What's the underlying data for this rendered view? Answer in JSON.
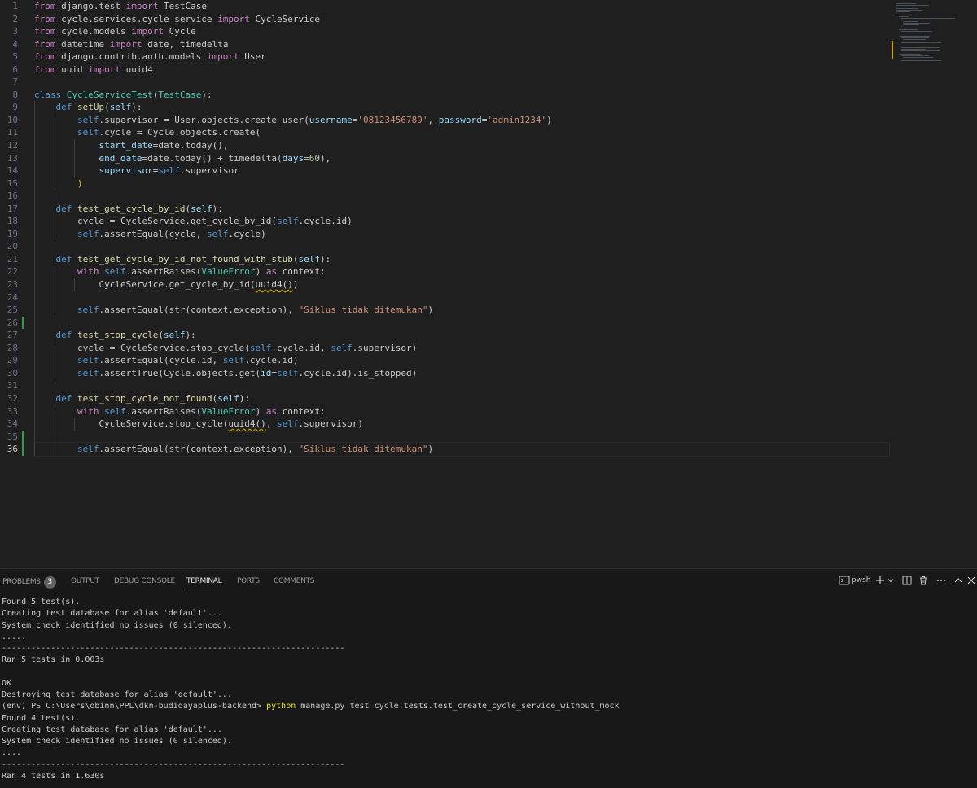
{
  "editor": {
    "active_line": 36,
    "lines": [
      [
        [
          "kw",
          "from"
        ],
        [
          "plain",
          " django.test "
        ],
        [
          "kw",
          "import"
        ],
        [
          "plain",
          " TestCase"
        ]
      ],
      [
        [
          "kw",
          "from"
        ],
        [
          "plain",
          " cycle.services.cycle_service "
        ],
        [
          "kw",
          "import"
        ],
        [
          "plain",
          " CycleService"
        ]
      ],
      [
        [
          "kw",
          "from"
        ],
        [
          "plain",
          " cycle.models "
        ],
        [
          "kw",
          "import"
        ],
        [
          "plain",
          " Cycle"
        ]
      ],
      [
        [
          "kw",
          "from"
        ],
        [
          "plain",
          " datetime "
        ],
        [
          "kw",
          "import"
        ],
        [
          "plain",
          " date, timedelta"
        ]
      ],
      [
        [
          "kw",
          "from"
        ],
        [
          "plain",
          " django.contrib.auth.models "
        ],
        [
          "kw",
          "import"
        ],
        [
          "plain",
          " User"
        ]
      ],
      [
        [
          "kw",
          "from"
        ],
        [
          "plain",
          " uuid "
        ],
        [
          "kw",
          "import"
        ],
        [
          "plain",
          " uuid4"
        ]
      ],
      [],
      [
        [
          "def",
          "class"
        ],
        [
          "plain",
          " "
        ],
        [
          "cls",
          "CycleServiceTest"
        ],
        [
          "plain",
          "("
        ],
        [
          "cls",
          "TestCase"
        ],
        [
          "plain",
          "):"
        ]
      ],
      [
        [
          "plain",
          "    "
        ],
        [
          "def",
          "def"
        ],
        [
          "plain",
          " "
        ],
        [
          "fn",
          "setUp"
        ],
        [
          "plain",
          "("
        ],
        [
          "param",
          "self"
        ],
        [
          "plain",
          "):"
        ]
      ],
      [
        [
          "plain",
          "        "
        ],
        [
          "self",
          "self"
        ],
        [
          "plain",
          ".supervisor = User.objects.create_user("
        ],
        [
          "param",
          "username"
        ],
        [
          "plain",
          "="
        ],
        [
          "str",
          "'08123456789'"
        ],
        [
          "plain",
          ", "
        ],
        [
          "param",
          "password"
        ],
        [
          "plain",
          "="
        ],
        [
          "str",
          "'admin1234'"
        ],
        [
          "plain",
          ")"
        ]
      ],
      [
        [
          "plain",
          "        "
        ],
        [
          "self",
          "self"
        ],
        [
          "plain",
          ".cycle = Cycle.objects.create("
        ]
      ],
      [
        [
          "plain",
          "            "
        ],
        [
          "param",
          "start_date"
        ],
        [
          "plain",
          "=date.today(),"
        ]
      ],
      [
        [
          "plain",
          "            "
        ],
        [
          "param",
          "end_date"
        ],
        [
          "plain",
          "=date.today() + timedelta("
        ],
        [
          "param",
          "days"
        ],
        [
          "plain",
          "="
        ],
        [
          "num",
          "60"
        ],
        [
          "plain",
          "),"
        ]
      ],
      [
        [
          "plain",
          "            "
        ],
        [
          "param",
          "supervisor"
        ],
        [
          "plain",
          "="
        ],
        [
          "self",
          "self"
        ],
        [
          "plain",
          ".supervisor"
        ]
      ],
      [
        [
          "plain",
          "        "
        ],
        [
          "brk",
          ")"
        ]
      ],
      [],
      [
        [
          "plain",
          "    "
        ],
        [
          "def",
          "def"
        ],
        [
          "plain",
          " "
        ],
        [
          "fn",
          "test_get_cycle_by_id"
        ],
        [
          "plain",
          "("
        ],
        [
          "param",
          "self"
        ],
        [
          "plain",
          "):"
        ]
      ],
      [
        [
          "plain",
          "        cycle = CycleService.get_cycle_by_id("
        ],
        [
          "self",
          "self"
        ],
        [
          "plain",
          ".cycle.id)"
        ]
      ],
      [
        [
          "plain",
          "        "
        ],
        [
          "self",
          "self"
        ],
        [
          "plain",
          ".assertEqual(cycle, "
        ],
        [
          "self",
          "self"
        ],
        [
          "plain",
          ".cycle)"
        ]
      ],
      [],
      [
        [
          "plain",
          "    "
        ],
        [
          "def",
          "def"
        ],
        [
          "plain",
          " "
        ],
        [
          "fn",
          "test_get_cycle_by_id_not_found_with_stub"
        ],
        [
          "plain",
          "("
        ],
        [
          "param",
          "self"
        ],
        [
          "plain",
          "):"
        ]
      ],
      [
        [
          "plain",
          "        "
        ],
        [
          "kw",
          "with"
        ],
        [
          "plain",
          " "
        ],
        [
          "self",
          "self"
        ],
        [
          "plain",
          ".assertRaises("
        ],
        [
          "cls",
          "ValueError"
        ],
        [
          "plain",
          ") "
        ],
        [
          "kw",
          "as"
        ],
        [
          "plain",
          " context:"
        ]
      ],
      [
        [
          "plain",
          "            CycleService.get_cycle_by_id("
        ],
        [
          "warn",
          "uuid4()"
        ],
        [
          "plain",
          ")"
        ]
      ],
      [],
      [
        [
          "plain",
          "        "
        ],
        [
          "self",
          "self"
        ],
        [
          "plain",
          ".assertEqual(str(context.exception), "
        ],
        [
          "str",
          "\"Siklus tidak ditemukan\""
        ],
        [
          "plain",
          ")"
        ]
      ],
      [],
      [
        [
          "plain",
          "    "
        ],
        [
          "def",
          "def"
        ],
        [
          "plain",
          " "
        ],
        [
          "fn",
          "test_stop_cycle"
        ],
        [
          "plain",
          "("
        ],
        [
          "param",
          "self"
        ],
        [
          "plain",
          "):"
        ]
      ],
      [
        [
          "plain",
          "        cycle = CycleService.stop_cycle("
        ],
        [
          "self",
          "self"
        ],
        [
          "plain",
          ".cycle.id, "
        ],
        [
          "self",
          "self"
        ],
        [
          "plain",
          ".supervisor)"
        ]
      ],
      [
        [
          "plain",
          "        "
        ],
        [
          "self",
          "self"
        ],
        [
          "plain",
          ".assertEqual(cycle.id, "
        ],
        [
          "self",
          "self"
        ],
        [
          "plain",
          ".cycle.id)"
        ]
      ],
      [
        [
          "plain",
          "        "
        ],
        [
          "self",
          "self"
        ],
        [
          "plain",
          ".assertTrue(Cycle.objects.get("
        ],
        [
          "param",
          "id"
        ],
        [
          "plain",
          "="
        ],
        [
          "self",
          "self"
        ],
        [
          "plain",
          ".cycle.id).is_stopped)"
        ]
      ],
      [],
      [
        [
          "plain",
          "    "
        ],
        [
          "def",
          "def"
        ],
        [
          "plain",
          " "
        ],
        [
          "fn",
          "test_stop_cycle_not_found"
        ],
        [
          "plain",
          "("
        ],
        [
          "param",
          "self"
        ],
        [
          "plain",
          "):"
        ]
      ],
      [
        [
          "plain",
          "        "
        ],
        [
          "kw",
          "with"
        ],
        [
          "plain",
          " "
        ],
        [
          "self",
          "self"
        ],
        [
          "plain",
          ".assertRaises("
        ],
        [
          "cls",
          "ValueError"
        ],
        [
          "plain",
          ") "
        ],
        [
          "kw",
          "as"
        ],
        [
          "plain",
          " context:"
        ]
      ],
      [
        [
          "plain",
          "            CycleService.stop_cycle("
        ],
        [
          "warn",
          "uuid4()"
        ],
        [
          "plain",
          ", "
        ],
        [
          "self",
          "self"
        ],
        [
          "plain",
          ".supervisor)"
        ]
      ],
      [],
      [
        [
          "plain",
          "        "
        ],
        [
          "self",
          "self"
        ],
        [
          "plain",
          ".assertEqual(str(context.exception), "
        ],
        [
          "str",
          "\"Siklus tidak ditemukan\""
        ],
        [
          "plain",
          ")"
        ]
      ]
    ]
  },
  "panel": {
    "tabs": [
      {
        "label": "PROBLEMS",
        "badge": "3"
      },
      {
        "label": "OUTPUT"
      },
      {
        "label": "DEBUG CONSOLE"
      },
      {
        "label": "TERMINAL",
        "active": true
      },
      {
        "label": "PORTS"
      },
      {
        "label": "COMMENTS"
      }
    ],
    "shell_label": "pwsh",
    "icons": [
      "terminal-icon",
      "plus-icon",
      "chevron-down-icon",
      "split-icon",
      "trash-icon",
      "more-icon",
      "chevron-up-icon",
      "close-icon"
    ]
  },
  "terminal": {
    "lines": [
      "Found 5 test(s).",
      "Creating test database for alias 'default'...",
      "System check identified no issues (0 silenced).",
      ".....",
      "----------------------------------------------------------------------",
      "Ran 5 tests in 0.003s",
      "",
      "OK",
      "Destroying test database for alias 'default'...",
      "Found 4 test(s).",
      "Creating test database for alias 'default'...",
      "System check identified no issues (0 silenced).",
      "....",
      "----------------------------------------------------------------------",
      "Ran 4 tests in 1.630s"
    ],
    "prompt": {
      "index": 9,
      "prefix": "(env) PS C:\\Users\\obinn\\PPL\\dkn-budidayaplus-backend> ",
      "command": "python",
      "args": " manage.py test cycle.tests.test_create_cycle_service_without_mock"
    }
  },
  "colors": {
    "editor_bg": "#1f1f1f",
    "panel_bg": "#181818",
    "keyword": "#c586c0",
    "def": "#569cd6",
    "function": "#dcdcaa",
    "class": "#4ec9b0",
    "string": "#ce9178",
    "number": "#b5cea8",
    "param": "#9cdcfe",
    "warning": "#cca700"
  }
}
